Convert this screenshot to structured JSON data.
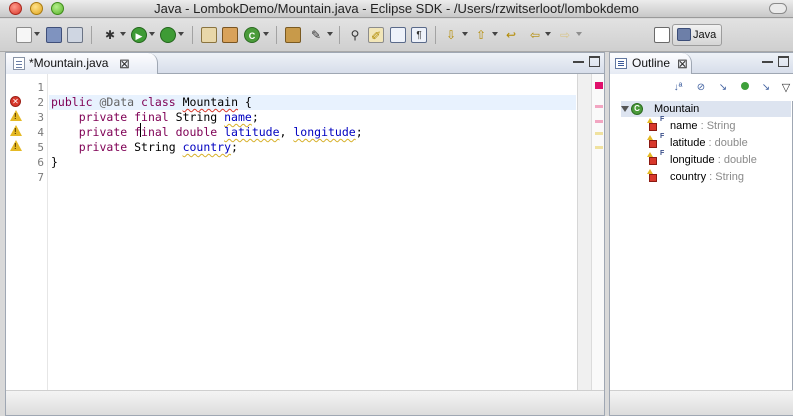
{
  "window": {
    "title": "Java - LombokDemo/Mountain.java - Eclipse SDK - /Users/rzwitserloot/lombokdemo"
  },
  "toolbar": {
    "icons": [
      "new-wizard-icon",
      "save-icon",
      "print-icon",
      "debug-icon",
      "run-icon",
      "external-tools-icon",
      "new-java-project-icon",
      "new-package-icon",
      "new-class-icon",
      "open-type-icon",
      "search-icon",
      "next-annotation-icon",
      "toggle-mark-occurrences-icon",
      "block-selection-icon",
      "show-whitespace-icon",
      "next-edit-icon",
      "prev-edit-icon",
      "back-icon",
      "forward-icon"
    ],
    "perspective_label": "Java"
  },
  "editor": {
    "tab_label": "*Mountain.java",
    "lines": [
      {
        "num": "1",
        "text": ""
      },
      {
        "num": "2",
        "text": "public @Data class Mountain {"
      },
      {
        "num": "3",
        "text": "    private final String name;"
      },
      {
        "num": "4",
        "text": "    private final double latitude, longitude;"
      },
      {
        "num": "5",
        "text": "    private String country;"
      },
      {
        "num": "6",
        "text": "}"
      },
      {
        "num": "7",
        "text": ""
      }
    ],
    "code_tokens": {
      "l2_public": "public",
      "l2_ann": "@Data",
      "l2_class": "class",
      "l2_name": "Mountain",
      "l2_brace": " {",
      "l3_kw": "private final",
      "l3_type": " String ",
      "l3_field": "name",
      "l3_end": ";",
      "l4_kw": "private final double",
      "l4_f1": "latitude",
      "l4_sep": ", ",
      "l4_f2": "longitude",
      "l4_end": ";",
      "l5_kw": "private",
      "l5_type": " String ",
      "l5_field": "country",
      "l5_end": ";",
      "l6": "}"
    },
    "markers": {
      "line2": "error",
      "line3": "warning",
      "line4": "warning",
      "line5": "warning"
    },
    "colors": {
      "keyword": "#7f0055",
      "annotation": "#646464",
      "field": "#0000c0",
      "error": "#d8382c",
      "warning": "#e5b924",
      "current_line": "#e8f2fe"
    }
  },
  "outline": {
    "tab_label": "Outline",
    "toolbar_icons": [
      "sort-icon",
      "hide-fields-icon",
      "hide-static-icon",
      "hide-non-public-icon",
      "hide-local-types-icon",
      "focus-icon"
    ],
    "class_name": "Mountain",
    "fields": [
      {
        "name": "name",
        "type": " : String",
        "final": true
      },
      {
        "name": "latitude",
        "type": " : double",
        "final": true
      },
      {
        "name": "longitude",
        "type": " : double",
        "final": true
      },
      {
        "name": "country",
        "type": " : String",
        "final": false
      }
    ],
    "final_marker": "F"
  }
}
